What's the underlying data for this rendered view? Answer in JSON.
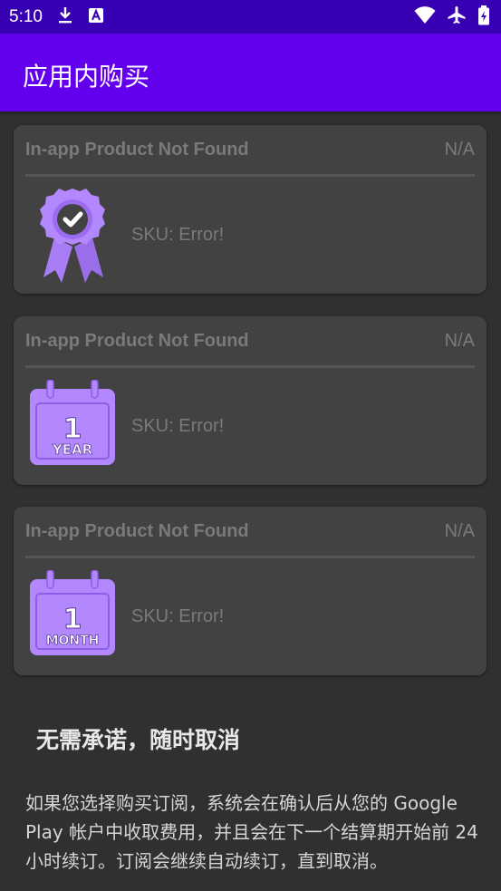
{
  "status_bar": {
    "time": "5:10",
    "left_icons": [
      "download-icon",
      "notification-a-icon"
    ],
    "right_icons": [
      "wifi-icon",
      "airplane-mode-icon",
      "battery-icon"
    ]
  },
  "app_bar": {
    "title": "应用内购买"
  },
  "products": [
    {
      "title": "In-app Product Not Found",
      "price": "N/A",
      "sku": "SKU: Error!",
      "icon": "award-badge-icon"
    },
    {
      "title": "In-app Product Not Found",
      "price": "N/A",
      "sku": "SKU: Error!",
      "icon": "calendar-year-icon",
      "calendar_number": "1",
      "calendar_label": "YEAR"
    },
    {
      "title": "In-app Product Not Found",
      "price": "N/A",
      "sku": "SKU: Error!",
      "icon": "calendar-month-icon",
      "calendar_number": "1",
      "calendar_label": "MONTH"
    }
  ],
  "notice": {
    "heading": "无需承诺，随时取消",
    "body": "如果您选择购买订阅，系统会在确认后从您的 Google Play 帐户中收取费用，并且会在下一个结算期开始前 24 小时续订。订阅会继续自动续订，直到取消。"
  },
  "colors": {
    "status_bar": "#3700b3",
    "app_bar": "#6200ee",
    "background": "#303030",
    "card": "#424242",
    "icon_purple": "#b388ff"
  }
}
